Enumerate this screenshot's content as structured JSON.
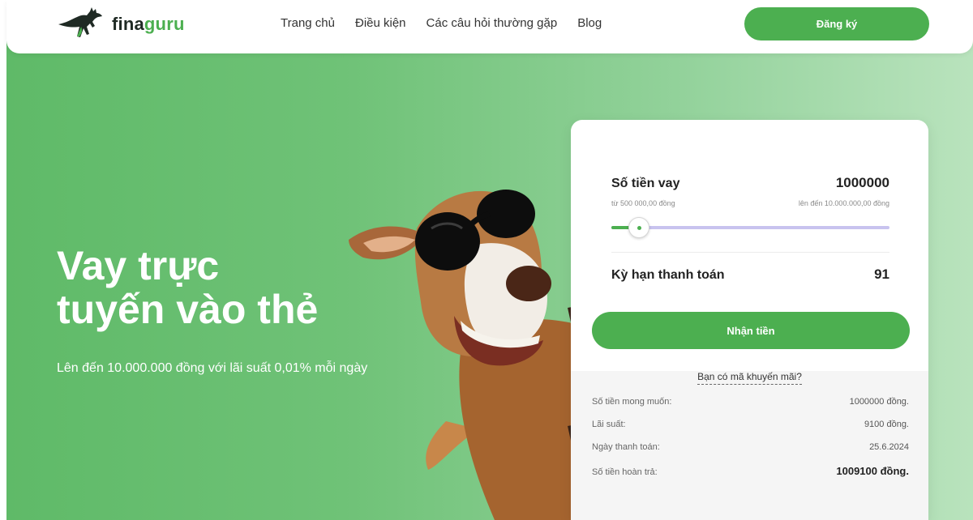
{
  "brand": {
    "name_dark": "fina",
    "name_green": "guru",
    "logo_icon": "kangaroo-icon",
    "accent_color": "#4caf50"
  },
  "nav": {
    "items": [
      "Trang chủ",
      "Điều kiện",
      "Các câu hỏi thường gặp",
      "Blog"
    ],
    "register_label": "Đăng ký"
  },
  "hero": {
    "title_line1": "Vay trực",
    "title_line2": "tuyến vào thẻ",
    "subtitle": "Lên đến 10.000.000 đồng với lãi suất 0,01% mỗi ngày",
    "mascot": "kangaroo-with-sunglasses-image"
  },
  "calculator": {
    "amount_label": "Số tiền vay",
    "amount_value": "1000000",
    "min_label": "từ 500 000,00 đồng",
    "max_label": "lên đến 10.000.000,00 đồng",
    "slider_percent": 10,
    "term_label": "Kỳ hạn thanh toán",
    "term_value": "91",
    "submit_label": "Nhận tiền",
    "promo_label": "Bạn có mã khuyến mãi?",
    "summary": [
      {
        "label": "Số tiền mong muốn:",
        "value": "1000000 đồng."
      },
      {
        "label": "Lãi suất:",
        "value": "9100 đồng."
      },
      {
        "label": "Ngày thanh toán:",
        "value": "25.6.2024"
      },
      {
        "label": "Số tiền hoàn trả:",
        "value": "1009100 đồng."
      }
    ]
  }
}
